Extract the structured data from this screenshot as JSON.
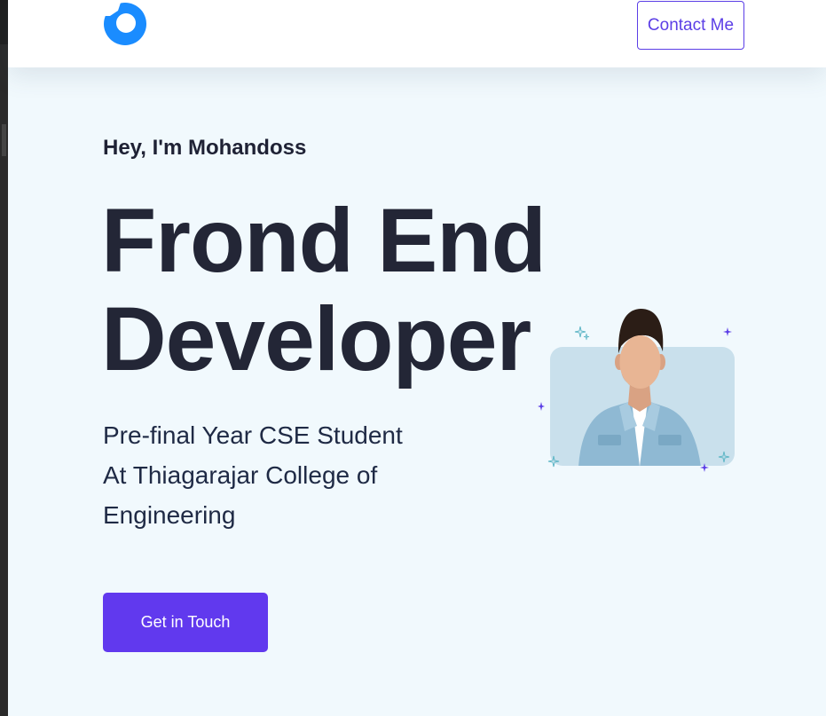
{
  "header": {
    "logo_icon": "brand-logo-icon",
    "contact_label": "Contact Me",
    "accent_color": "#5b3ee6"
  },
  "hero": {
    "greeting": "Hey, I'm Mohandoss",
    "headline_line1": "Frond End",
    "headline_line2": "Developer",
    "subtitle_line1": "Pre-final Year CSE Student",
    "subtitle_line2": "At Thiagarajar College of",
    "subtitle_line3": "Engineering",
    "cta_label": "Get in Touch",
    "cta_color": "#6139ee",
    "background_color": "#f1f9fd"
  },
  "profile": {
    "image_icon": "profile-photo",
    "sparkle_icon": "sparkle-icon"
  }
}
